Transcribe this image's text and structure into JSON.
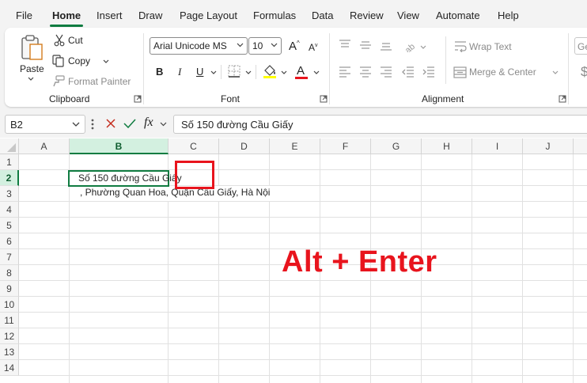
{
  "menu": {
    "tabs": [
      "File",
      "Home",
      "Insert",
      "Draw",
      "Page Layout",
      "Formulas",
      "Data",
      "Review",
      "View",
      "Automate",
      "Help"
    ],
    "active_tab": "Home"
  },
  "ribbon": {
    "clipboard": {
      "paste_label": "Paste",
      "cut_label": "Cut",
      "copy_label": "Copy",
      "format_painter_label": "Format Painter",
      "group_label": "Clipboard"
    },
    "font": {
      "font_name": "Arial Unicode MS",
      "font_size": "10",
      "bold_label": "B",
      "italic_label": "I",
      "underline_label": "U",
      "font_color_label": "A",
      "font_color": "#e8141d",
      "fill_color": "#ffff00",
      "grow_label": "A",
      "shrink_label": "A",
      "group_label": "Font"
    },
    "alignment": {
      "wrap_text_label": "Wrap Text",
      "merge_center_label": "Merge & Center",
      "group_label": "Alignment"
    },
    "number": {
      "format_partial": "Ge",
      "currency_partial": "$"
    }
  },
  "formula_bar": {
    "name_box": "B2",
    "fx_label": "fx",
    "formula": "Số 150 đường Cầu Giấy"
  },
  "grid": {
    "columns": [
      "A",
      "B",
      "C",
      "D",
      "E",
      "F",
      "G",
      "H",
      "I",
      "J"
    ],
    "rows": [
      "1",
      "2",
      "3",
      "4",
      "5",
      "6",
      "7",
      "8",
      "9",
      "10",
      "11",
      "12",
      "13",
      "14"
    ],
    "selected_cell": "B2",
    "cell_b2_line1": "Số 150 đường Cầu Giấy",
    "cell_b2_line2": ", Phường Quan Hoa, Quận Cầu Giấy, Hà Nội"
  },
  "annotation": {
    "text": "Alt + Enter",
    "color": "#e8141d"
  },
  "colors": {
    "accent_green": "#107c41",
    "highlight_red": "#e8141d"
  }
}
